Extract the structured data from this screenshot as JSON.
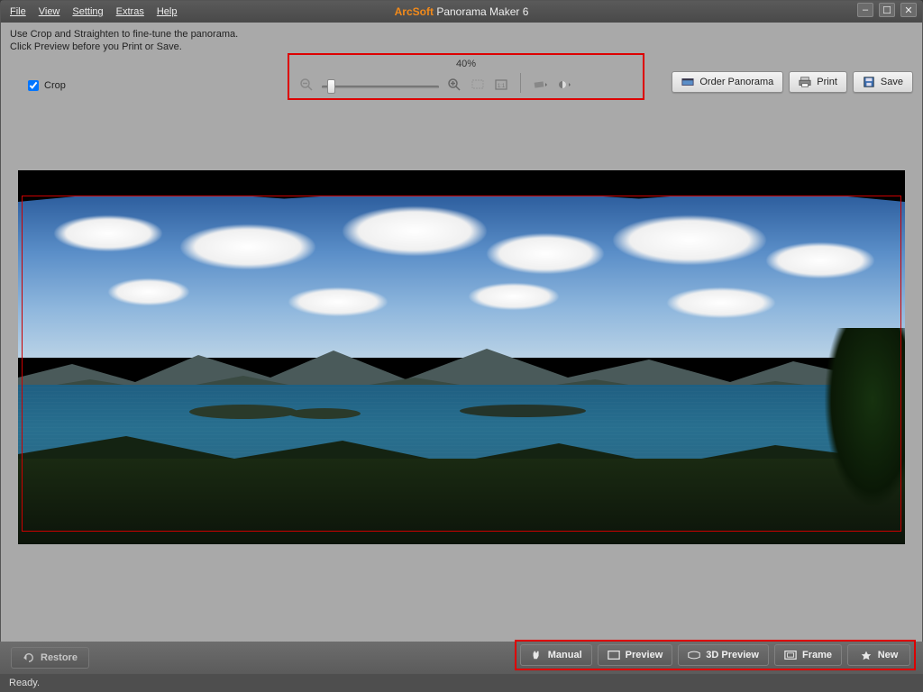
{
  "title": {
    "brand": "ArcSoft",
    "product": "Panorama Maker 6"
  },
  "menu": [
    "File",
    "View",
    "Setting",
    "Extras",
    "Help"
  ],
  "hint": {
    "line1": "Use Crop and Straighten to fine-tune the panorama.",
    "line2": "Click Preview before you Print or Save."
  },
  "crop": {
    "label": "Crop",
    "checked": true
  },
  "zoom": {
    "percent_label": "40%",
    "value": 40
  },
  "actions": {
    "order": "Order Panorama",
    "print": "Print",
    "save": "Save"
  },
  "bottom": {
    "restore": "Restore",
    "manual": "Manual",
    "preview": "Preview",
    "preview3d": "3D Preview",
    "frame": "Frame",
    "new": "New"
  },
  "status": "Ready.",
  "colors": {
    "highlight": "#d00",
    "brand": "#f28a1a"
  }
}
